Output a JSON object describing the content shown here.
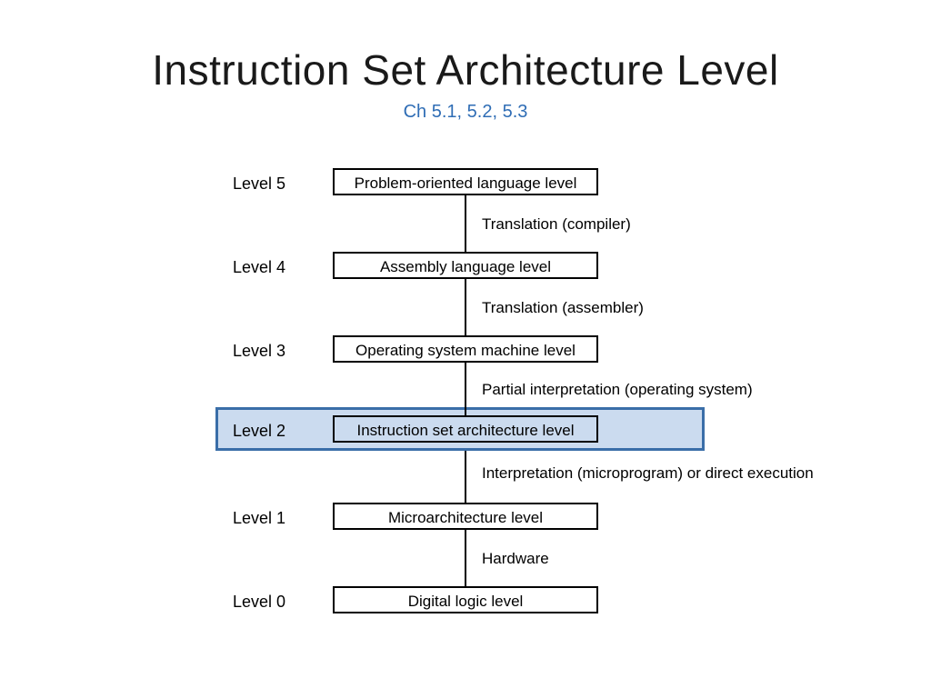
{
  "title": "Instruction Set Architecture Level",
  "subtitle": "Ch 5.1, 5.2, 5.3",
  "levels": {
    "l5": {
      "num": "Level 5",
      "name": "Problem-oriented language level"
    },
    "l4": {
      "num": "Level 4",
      "name": "Assembly language level"
    },
    "l3": {
      "num": "Level 3",
      "name": "Operating system machine level"
    },
    "l2": {
      "num": "Level 2",
      "name": "Instruction set architecture level"
    },
    "l1": {
      "num": "Level 1",
      "name": "Microarchitecture level"
    },
    "l0": {
      "num": "Level 0",
      "name": "Digital logic level"
    }
  },
  "transitions": {
    "t54": "Translation (compiler)",
    "t43": "Translation (assembler)",
    "t32": "Partial interpretation (operating system)",
    "t21": "Interpretation (microprogram) or direct execution",
    "t10": "Hardware"
  }
}
